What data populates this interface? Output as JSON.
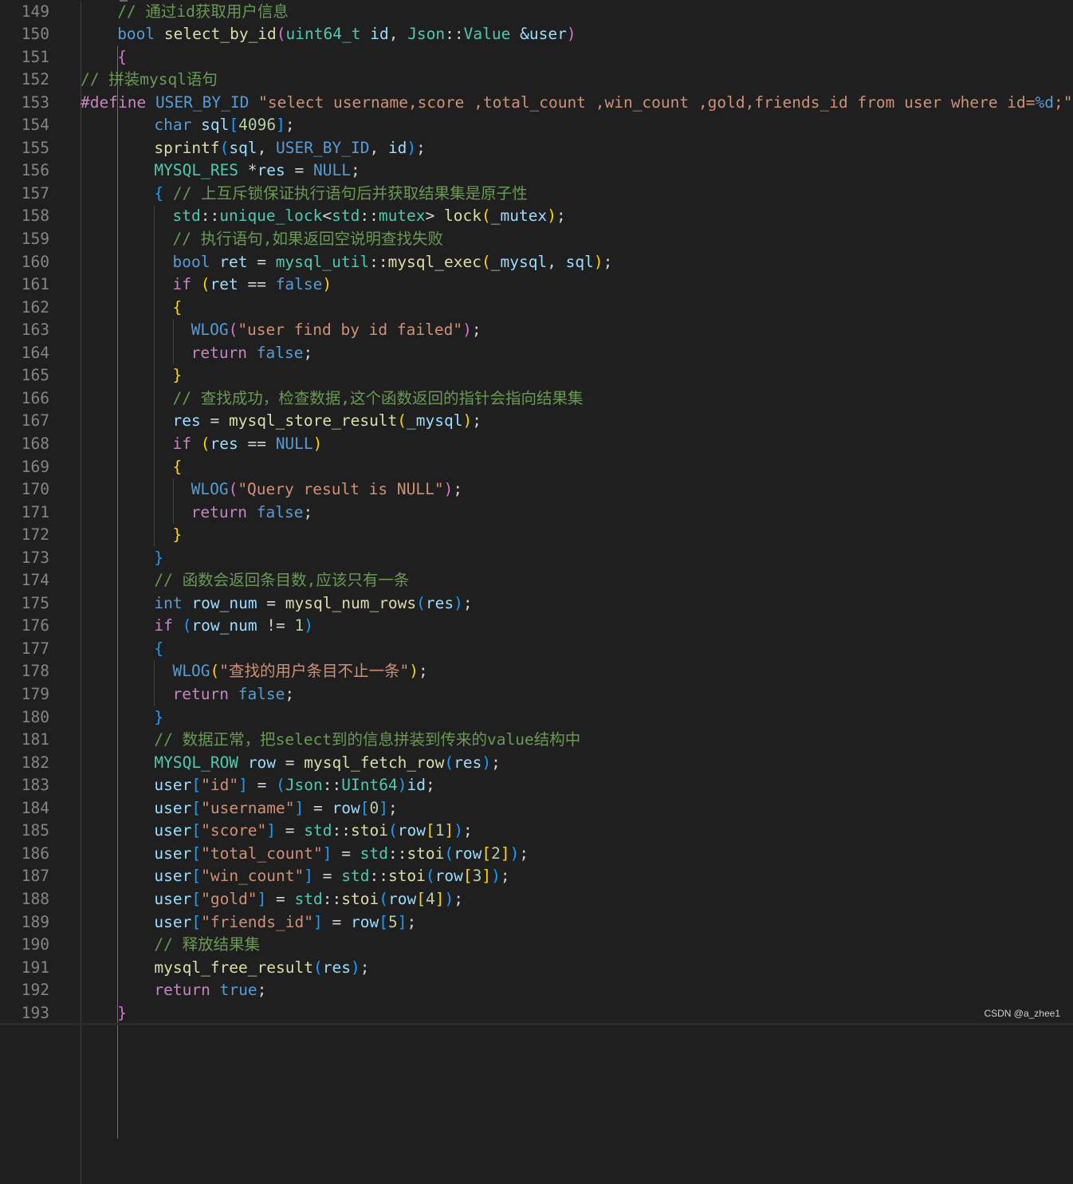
{
  "colors": {
    "background": "#1f1f1f",
    "line_number": "#858585",
    "default_text": "#d4d4d4",
    "variable": "#9cdcfe",
    "keyword_blue": "#569cd6",
    "control": "#c586c0",
    "type": "#4ec9b0",
    "function": "#dcdcaa",
    "string": "#ce9178",
    "number": "#b5cea8",
    "comment": "#6a9955",
    "bracket1": "#ffd700",
    "bracket2": "#da70d6",
    "bracket3": "#179fff"
  },
  "lines": [
    {
      "n": "149",
      "i": 4,
      "t": [
        [
          "// 通过id获取用户信息",
          "comment"
        ]
      ]
    },
    {
      "n": "150",
      "i": 4,
      "t": [
        [
          "bool",
          "kw"
        ],
        [
          " ",
          ""
        ],
        [
          "select_by_id",
          "fn"
        ],
        [
          "(",
          "b2"
        ],
        [
          "uint64_t",
          "type"
        ],
        [
          " ",
          ""
        ],
        [
          "id",
          "var"
        ],
        [
          ", ",
          ""
        ],
        [
          "Json",
          "type"
        ],
        [
          "::",
          ""
        ],
        [
          "Value",
          "type"
        ],
        [
          " ",
          ""
        ],
        [
          "&",
          "var"
        ],
        [
          "user",
          "var"
        ],
        [
          ")",
          "b2"
        ]
      ]
    },
    {
      "n": "151",
      "i": 4,
      "t": [
        [
          "{",
          "b2"
        ]
      ]
    },
    {
      "n": "152",
      "i": 0,
      "t": [
        [
          "// 拼装mysql语句",
          "comment"
        ]
      ]
    },
    {
      "n": "153",
      "i": 0,
      "t": [
        [
          "#define",
          "ctrl"
        ],
        [
          " ",
          ""
        ],
        [
          "USER_BY_ID",
          "kw"
        ],
        [
          " ",
          ""
        ],
        [
          "\"select username,score ,total_count ,win_count ,gold,friends_id from user where id=",
          "str"
        ],
        [
          "%d",
          "kw"
        ],
        [
          ";\"",
          "str"
        ]
      ]
    },
    {
      "n": "154",
      "i": 8,
      "t": [
        [
          "char",
          "kw"
        ],
        [
          " ",
          ""
        ],
        [
          "sql",
          "var"
        ],
        [
          "[",
          "b3"
        ],
        [
          "4096",
          "num"
        ],
        [
          "]",
          "b3"
        ],
        [
          ";",
          ""
        ]
      ]
    },
    {
      "n": "155",
      "i": 8,
      "t": [
        [
          "sprintf",
          "fn"
        ],
        [
          "(",
          "b3"
        ],
        [
          "sql",
          "var"
        ],
        [
          ", ",
          ""
        ],
        [
          "USER_BY_ID",
          "kw"
        ],
        [
          ", ",
          ""
        ],
        [
          "id",
          "var"
        ],
        [
          ")",
          "b3"
        ],
        [
          ";",
          ""
        ]
      ]
    },
    {
      "n": "156",
      "i": 8,
      "t": [
        [
          "MYSQL_RES",
          "type"
        ],
        [
          " *",
          ""
        ],
        [
          "res",
          "var"
        ],
        [
          " = ",
          ""
        ],
        [
          "NULL",
          "kw"
        ],
        [
          ";",
          ""
        ]
      ]
    },
    {
      "n": "157",
      "i": 8,
      "t": [
        [
          "{",
          "b3"
        ],
        [
          " ",
          ""
        ],
        [
          "// 上互斥锁保证执行语句后并获取结果集是原子性",
          "comment"
        ]
      ]
    },
    {
      "n": "158",
      "i": 10,
      "t": [
        [
          "std",
          "type"
        ],
        [
          "::",
          ""
        ],
        [
          "unique_lock",
          "type"
        ],
        [
          "<",
          ""
        ],
        [
          "std",
          "type"
        ],
        [
          "::",
          ""
        ],
        [
          "mutex",
          "type"
        ],
        [
          "> ",
          ""
        ],
        [
          "lock",
          "fn"
        ],
        [
          "(",
          "b1"
        ],
        [
          "_mutex",
          "var"
        ],
        [
          ")",
          "b1"
        ],
        [
          ";",
          ""
        ]
      ]
    },
    {
      "n": "159",
      "i": 10,
      "t": [
        [
          "// 执行语句,如果返回空说明查找失败",
          "comment"
        ]
      ]
    },
    {
      "n": "160",
      "i": 10,
      "t": [
        [
          "bool",
          "kw"
        ],
        [
          " ",
          ""
        ],
        [
          "ret",
          "var"
        ],
        [
          " = ",
          ""
        ],
        [
          "mysql_util",
          "type"
        ],
        [
          "::",
          ""
        ],
        [
          "mysql_exec",
          "fn"
        ],
        [
          "(",
          "b1"
        ],
        [
          "_mysql",
          "var"
        ],
        [
          ", ",
          ""
        ],
        [
          "sql",
          "var"
        ],
        [
          ")",
          "b1"
        ],
        [
          ";",
          ""
        ]
      ]
    },
    {
      "n": "161",
      "i": 10,
      "t": [
        [
          "if",
          "ctrl"
        ],
        [
          " ",
          ""
        ],
        [
          "(",
          "b1"
        ],
        [
          "ret",
          "var"
        ],
        [
          " == ",
          ""
        ],
        [
          "false",
          "kw"
        ],
        [
          ")",
          "b1"
        ]
      ]
    },
    {
      "n": "162",
      "i": 10,
      "t": [
        [
          "{",
          "b1"
        ]
      ]
    },
    {
      "n": "163",
      "i": 12,
      "t": [
        [
          "WLOG",
          "kw"
        ],
        [
          "(",
          "b2"
        ],
        [
          "\"user find by id failed\"",
          "str"
        ],
        [
          ")",
          "b2"
        ],
        [
          ";",
          ""
        ]
      ]
    },
    {
      "n": "164",
      "i": 12,
      "t": [
        [
          "return",
          "ctrl"
        ],
        [
          " ",
          ""
        ],
        [
          "false",
          "kw"
        ],
        [
          ";",
          ""
        ]
      ]
    },
    {
      "n": "165",
      "i": 10,
      "t": [
        [
          "}",
          "b1"
        ]
      ]
    },
    {
      "n": "166",
      "i": 10,
      "t": [
        [
          "// 查找成功，检查数据,这个函数返回的指针会指向结果集",
          "comment"
        ]
      ]
    },
    {
      "n": "167",
      "i": 10,
      "t": [
        [
          "res",
          "var"
        ],
        [
          " = ",
          ""
        ],
        [
          "mysql_store_result",
          "fn"
        ],
        [
          "(",
          "b1"
        ],
        [
          "_mysql",
          "var"
        ],
        [
          ")",
          "b1"
        ],
        [
          ";",
          ""
        ]
      ]
    },
    {
      "n": "168",
      "i": 10,
      "t": [
        [
          "if",
          "ctrl"
        ],
        [
          " ",
          ""
        ],
        [
          "(",
          "b1"
        ],
        [
          "res",
          "var"
        ],
        [
          " == ",
          ""
        ],
        [
          "NULL",
          "kw"
        ],
        [
          ")",
          "b1"
        ]
      ]
    },
    {
      "n": "169",
      "i": 10,
      "t": [
        [
          "{",
          "b1"
        ]
      ]
    },
    {
      "n": "170",
      "i": 12,
      "t": [
        [
          "WLOG",
          "kw"
        ],
        [
          "(",
          "b2"
        ],
        [
          "\"Query result is NULL\"",
          "str"
        ],
        [
          ")",
          "b2"
        ],
        [
          ";",
          ""
        ]
      ]
    },
    {
      "n": "171",
      "i": 12,
      "t": [
        [
          "return",
          "ctrl"
        ],
        [
          " ",
          ""
        ],
        [
          "false",
          "kw"
        ],
        [
          ";",
          ""
        ]
      ]
    },
    {
      "n": "172",
      "i": 10,
      "t": [
        [
          "}",
          "b1"
        ]
      ]
    },
    {
      "n": "173",
      "i": 8,
      "t": [
        [
          "}",
          "b3"
        ]
      ]
    },
    {
      "n": "174",
      "i": 8,
      "t": [
        [
          "// 函数会返回条目数,应该只有一条",
          "comment"
        ]
      ]
    },
    {
      "n": "175",
      "i": 8,
      "t": [
        [
          "int",
          "kw"
        ],
        [
          " ",
          ""
        ],
        [
          "row_num",
          "var"
        ],
        [
          " = ",
          ""
        ],
        [
          "mysql_num_rows",
          "fn"
        ],
        [
          "(",
          "b3"
        ],
        [
          "res",
          "var"
        ],
        [
          ")",
          "b3"
        ],
        [
          ";",
          ""
        ]
      ]
    },
    {
      "n": "176",
      "i": 8,
      "t": [
        [
          "if",
          "ctrl"
        ],
        [
          " ",
          ""
        ],
        [
          "(",
          "b3"
        ],
        [
          "row_num",
          "var"
        ],
        [
          " != ",
          ""
        ],
        [
          "1",
          "num"
        ],
        [
          ")",
          "b3"
        ]
      ]
    },
    {
      "n": "177",
      "i": 8,
      "t": [
        [
          "{",
          "b3"
        ]
      ]
    },
    {
      "n": "178",
      "i": 10,
      "t": [
        [
          "WLOG",
          "kw"
        ],
        [
          "(",
          "b1"
        ],
        [
          "\"查找的用户条目不止一条\"",
          "str"
        ],
        [
          ")",
          "b1"
        ],
        [
          ";",
          ""
        ]
      ]
    },
    {
      "n": "179",
      "i": 10,
      "t": [
        [
          "return",
          "ctrl"
        ],
        [
          " ",
          ""
        ],
        [
          "false",
          "kw"
        ],
        [
          ";",
          ""
        ]
      ]
    },
    {
      "n": "180",
      "i": 8,
      "t": [
        [
          "}",
          "b3"
        ]
      ]
    },
    {
      "n": "181",
      "i": 8,
      "t": [
        [
          "// 数据正常，把select到的信息拼装到传来的value结构中",
          "comment"
        ]
      ]
    },
    {
      "n": "182",
      "i": 8,
      "t": [
        [
          "MYSQL_ROW",
          "type"
        ],
        [
          " ",
          ""
        ],
        [
          "row",
          "var"
        ],
        [
          " = ",
          ""
        ],
        [
          "mysql_fetch_row",
          "fn"
        ],
        [
          "(",
          "b3"
        ],
        [
          "res",
          "var"
        ],
        [
          ")",
          "b3"
        ],
        [
          ";",
          ""
        ]
      ]
    },
    {
      "n": "183",
      "i": 8,
      "t": [
        [
          "user",
          "var"
        ],
        [
          "[",
          "b3"
        ],
        [
          "\"id\"",
          "str"
        ],
        [
          "]",
          "b3"
        ],
        [
          " = ",
          ""
        ],
        [
          "(",
          "b3"
        ],
        [
          "Json",
          "type"
        ],
        [
          "::",
          ""
        ],
        [
          "UInt64",
          "type"
        ],
        [
          ")",
          "b3"
        ],
        [
          "id",
          "var"
        ],
        [
          ";",
          ""
        ]
      ]
    },
    {
      "n": "184",
      "i": 8,
      "t": [
        [
          "user",
          "var"
        ],
        [
          "[",
          "b3"
        ],
        [
          "\"username\"",
          "str"
        ],
        [
          "]",
          "b3"
        ],
        [
          " = ",
          ""
        ],
        [
          "row",
          "var"
        ],
        [
          "[",
          "b3"
        ],
        [
          "0",
          "num"
        ],
        [
          "]",
          "b3"
        ],
        [
          ";",
          ""
        ]
      ]
    },
    {
      "n": "185",
      "i": 8,
      "t": [
        [
          "user",
          "var"
        ],
        [
          "[",
          "b3"
        ],
        [
          "\"score\"",
          "str"
        ],
        [
          "]",
          "b3"
        ],
        [
          " = ",
          ""
        ],
        [
          "std",
          "type"
        ],
        [
          "::",
          ""
        ],
        [
          "stoi",
          "fn"
        ],
        [
          "(",
          "b3"
        ],
        [
          "row",
          "var"
        ],
        [
          "[",
          "b1"
        ],
        [
          "1",
          "num"
        ],
        [
          "]",
          "b1"
        ],
        [
          ")",
          "b3"
        ],
        [
          ";",
          ""
        ]
      ]
    },
    {
      "n": "186",
      "i": 8,
      "t": [
        [
          "user",
          "var"
        ],
        [
          "[",
          "b3"
        ],
        [
          "\"total_count\"",
          "str"
        ],
        [
          "]",
          "b3"
        ],
        [
          " = ",
          ""
        ],
        [
          "std",
          "type"
        ],
        [
          "::",
          ""
        ],
        [
          "stoi",
          "fn"
        ],
        [
          "(",
          "b3"
        ],
        [
          "row",
          "var"
        ],
        [
          "[",
          "b1"
        ],
        [
          "2",
          "num"
        ],
        [
          "]",
          "b1"
        ],
        [
          ")",
          "b3"
        ],
        [
          ";",
          ""
        ]
      ]
    },
    {
      "n": "187",
      "i": 8,
      "t": [
        [
          "user",
          "var"
        ],
        [
          "[",
          "b3"
        ],
        [
          "\"win_count\"",
          "str"
        ],
        [
          "]",
          "b3"
        ],
        [
          " = ",
          ""
        ],
        [
          "std",
          "type"
        ],
        [
          "::",
          ""
        ],
        [
          "stoi",
          "fn"
        ],
        [
          "(",
          "b3"
        ],
        [
          "row",
          "var"
        ],
        [
          "[",
          "b1"
        ],
        [
          "3",
          "num"
        ],
        [
          "]",
          "b1"
        ],
        [
          ")",
          "b3"
        ],
        [
          ";",
          ""
        ]
      ]
    },
    {
      "n": "188",
      "i": 8,
      "t": [
        [
          "user",
          "var"
        ],
        [
          "[",
          "b3"
        ],
        [
          "\"gold\"",
          "str"
        ],
        [
          "]",
          "b3"
        ],
        [
          " = ",
          ""
        ],
        [
          "std",
          "type"
        ],
        [
          "::",
          ""
        ],
        [
          "stoi",
          "fn"
        ],
        [
          "(",
          "b3"
        ],
        [
          "row",
          "var"
        ],
        [
          "[",
          "b1"
        ],
        [
          "4",
          "num"
        ],
        [
          "]",
          "b1"
        ],
        [
          ")",
          "b3"
        ],
        [
          ";",
          ""
        ]
      ]
    },
    {
      "n": "189",
      "i": 8,
      "t": [
        [
          "user",
          "var"
        ],
        [
          "[",
          "b3"
        ],
        [
          "\"friends_id\"",
          "str"
        ],
        [
          "]",
          "b3"
        ],
        [
          " = ",
          ""
        ],
        [
          "row",
          "var"
        ],
        [
          "[",
          "b3"
        ],
        [
          "5",
          "num"
        ],
        [
          "]",
          "b3"
        ],
        [
          ";",
          ""
        ]
      ]
    },
    {
      "n": "190",
      "i": 8,
      "t": [
        [
          "// 释放结果集",
          "comment"
        ]
      ]
    },
    {
      "n": "191",
      "i": 8,
      "t": [
        [
          "mysql_free_result",
          "fn"
        ],
        [
          "(",
          "b3"
        ],
        [
          "res",
          "var"
        ],
        [
          ")",
          "b3"
        ],
        [
          ";",
          ""
        ]
      ]
    },
    {
      "n": "192",
      "i": 8,
      "t": [
        [
          "return",
          "ctrl"
        ],
        [
          " ",
          ""
        ],
        [
          "true",
          "kw"
        ],
        [
          ";",
          ""
        ]
      ]
    },
    {
      "n": "193",
      "i": 4,
      "t": [
        [
          "}",
          "b2"
        ]
      ]
    }
  ],
  "watermark": "CSDN @a_zhee1"
}
